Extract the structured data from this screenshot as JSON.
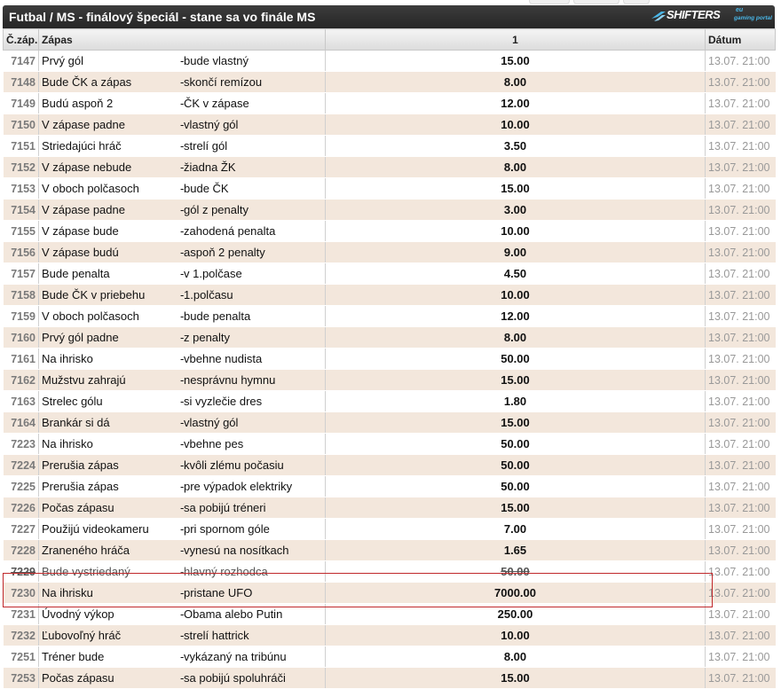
{
  "header": {
    "title": "Futbal / MS - finálový špeciál - stane sa vo finále MS",
    "logo_text": "SHIFTERS",
    "logo_sup": "eu",
    "logo_sub": "gaming portal"
  },
  "columns": {
    "num": "Č.záp.",
    "match": "Zápas",
    "odd": "1",
    "date": "Dátum"
  },
  "colors": {
    "title_bg": "#2b2b2b",
    "row_alt": "#f3e7dc",
    "highlight": "#c0282b",
    "logo_accent": "#4ab7e8"
  },
  "rows": [
    {
      "num": "7147",
      "t1": "Prvý gól",
      "t2": "bude vlastný",
      "odd": "15.00",
      "date": "13.07. 21:00"
    },
    {
      "num": "7148",
      "t1": "Bude ČK a zápas",
      "t2": "skončí remízou",
      "odd": "8.00",
      "date": "13.07. 21:00"
    },
    {
      "num": "7149",
      "t1": "Budú aspoň 2",
      "t2": "ČK v zápase",
      "odd": "12.00",
      "date": "13.07. 21:00"
    },
    {
      "num": "7150",
      "t1": "V zápase padne",
      "t2": "vlastný gól",
      "odd": "10.00",
      "date": "13.07. 21:00"
    },
    {
      "num": "7151",
      "t1": "Striedajúci hráč",
      "t2": "strelí gól",
      "odd": "3.50",
      "date": "13.07. 21:00"
    },
    {
      "num": "7152",
      "t1": "V zápase nebude",
      "t2": "žiadna ŽK",
      "odd": "8.00",
      "date": "13.07. 21:00"
    },
    {
      "num": "7153",
      "t1": "V oboch polčasoch",
      "t2": "bude ČK",
      "odd": "15.00",
      "date": "13.07. 21:00"
    },
    {
      "num": "7154",
      "t1": "V zápase padne",
      "t2": "gól z penalty",
      "odd": "3.00",
      "date": "13.07. 21:00"
    },
    {
      "num": "7155",
      "t1": "V zápase bude",
      "t2": "zahodená penalta",
      "odd": "10.00",
      "date": "13.07. 21:00"
    },
    {
      "num": "7156",
      "t1": "V zápase budú",
      "t2": "aspoň 2 penalty",
      "odd": "9.00",
      "date": "13.07. 21:00"
    },
    {
      "num": "7157",
      "t1": "Bude penalta",
      "t2": "v 1.polčase",
      "odd": "4.50",
      "date": "13.07. 21:00"
    },
    {
      "num": "7158",
      "t1": "Bude ČK v priebehu",
      "t2": "1.polčasu",
      "odd": "10.00",
      "date": "13.07. 21:00"
    },
    {
      "num": "7159",
      "t1": "V oboch polčasoch",
      "t2": "bude penalta",
      "odd": "12.00",
      "date": "13.07. 21:00"
    },
    {
      "num": "7160",
      "t1": "Prvý gól padne",
      "t2": "z penalty",
      "odd": "8.00",
      "date": "13.07. 21:00"
    },
    {
      "num": "7161",
      "t1": "Na ihrisko",
      "t2": "vbehne nudista",
      "odd": "50.00",
      "date": "13.07. 21:00"
    },
    {
      "num": "7162",
      "t1": "Mužstvu zahrajú",
      "t2": "nesprávnu hymnu",
      "odd": "15.00",
      "date": "13.07. 21:00"
    },
    {
      "num": "7163",
      "t1": "Strelec gólu",
      "t2": "si vyzlečie dres",
      "odd": "1.80",
      "date": "13.07. 21:00"
    },
    {
      "num": "7164",
      "t1": "Brankár si dá",
      "t2": "vlastný gól",
      "odd": "15.00",
      "date": "13.07. 21:00"
    },
    {
      "num": "7223",
      "t1": "Na ihrisko",
      "t2": "vbehne pes",
      "odd": "50.00",
      "date": "13.07. 21:00"
    },
    {
      "num": "7224",
      "t1": "Prerušia zápas",
      "t2": "kvôli zlému počasiu",
      "odd": "50.00",
      "date": "13.07. 21:00"
    },
    {
      "num": "7225",
      "t1": "Prerušia zápas",
      "t2": "pre výpadok elektriky",
      "odd": "50.00",
      "date": "13.07. 21:00"
    },
    {
      "num": "7226",
      "t1": "Počas zápasu",
      "t2": "sa pobijú tréneri",
      "odd": "15.00",
      "date": "13.07. 21:00"
    },
    {
      "num": "7227",
      "t1": "Použijú videokameru",
      "t2": "pri spornom góle",
      "odd": "7.00",
      "date": "13.07. 21:00"
    },
    {
      "num": "7228",
      "t1": "Zraneného hráča",
      "t2": "vynesú na nosítkach",
      "odd": "1.65",
      "date": "13.07. 21:00"
    },
    {
      "num": "7229",
      "t1": "Bude vystriedaný",
      "t2": "hlavný rozhodca",
      "odd": "50.00",
      "date": "13.07. 21:00",
      "strike": true
    },
    {
      "num": "7230",
      "t1": "Na ihrisku",
      "t2": "pristane UFO",
      "odd": "7000.00",
      "date": "13.07. 21:00"
    },
    {
      "num": "7231",
      "t1": "Úvodný výkop",
      "t2": "Obama alebo Putin",
      "odd": "250.00",
      "date": "13.07. 21:00"
    },
    {
      "num": "7232",
      "t1": "Ľubovoľný hráč",
      "t2": "strelí hattrick",
      "odd": "10.00",
      "date": "13.07. 21:00"
    },
    {
      "num": "7251",
      "t1": "Tréner bude",
      "t2": "vykázaný na tribúnu",
      "odd": "8.00",
      "date": "13.07. 21:00"
    },
    {
      "num": "7253",
      "t1": "Počas zápasu",
      "t2": "sa pobijú spoluhráči",
      "odd": "15.00",
      "date": "13.07. 21:00"
    }
  ]
}
